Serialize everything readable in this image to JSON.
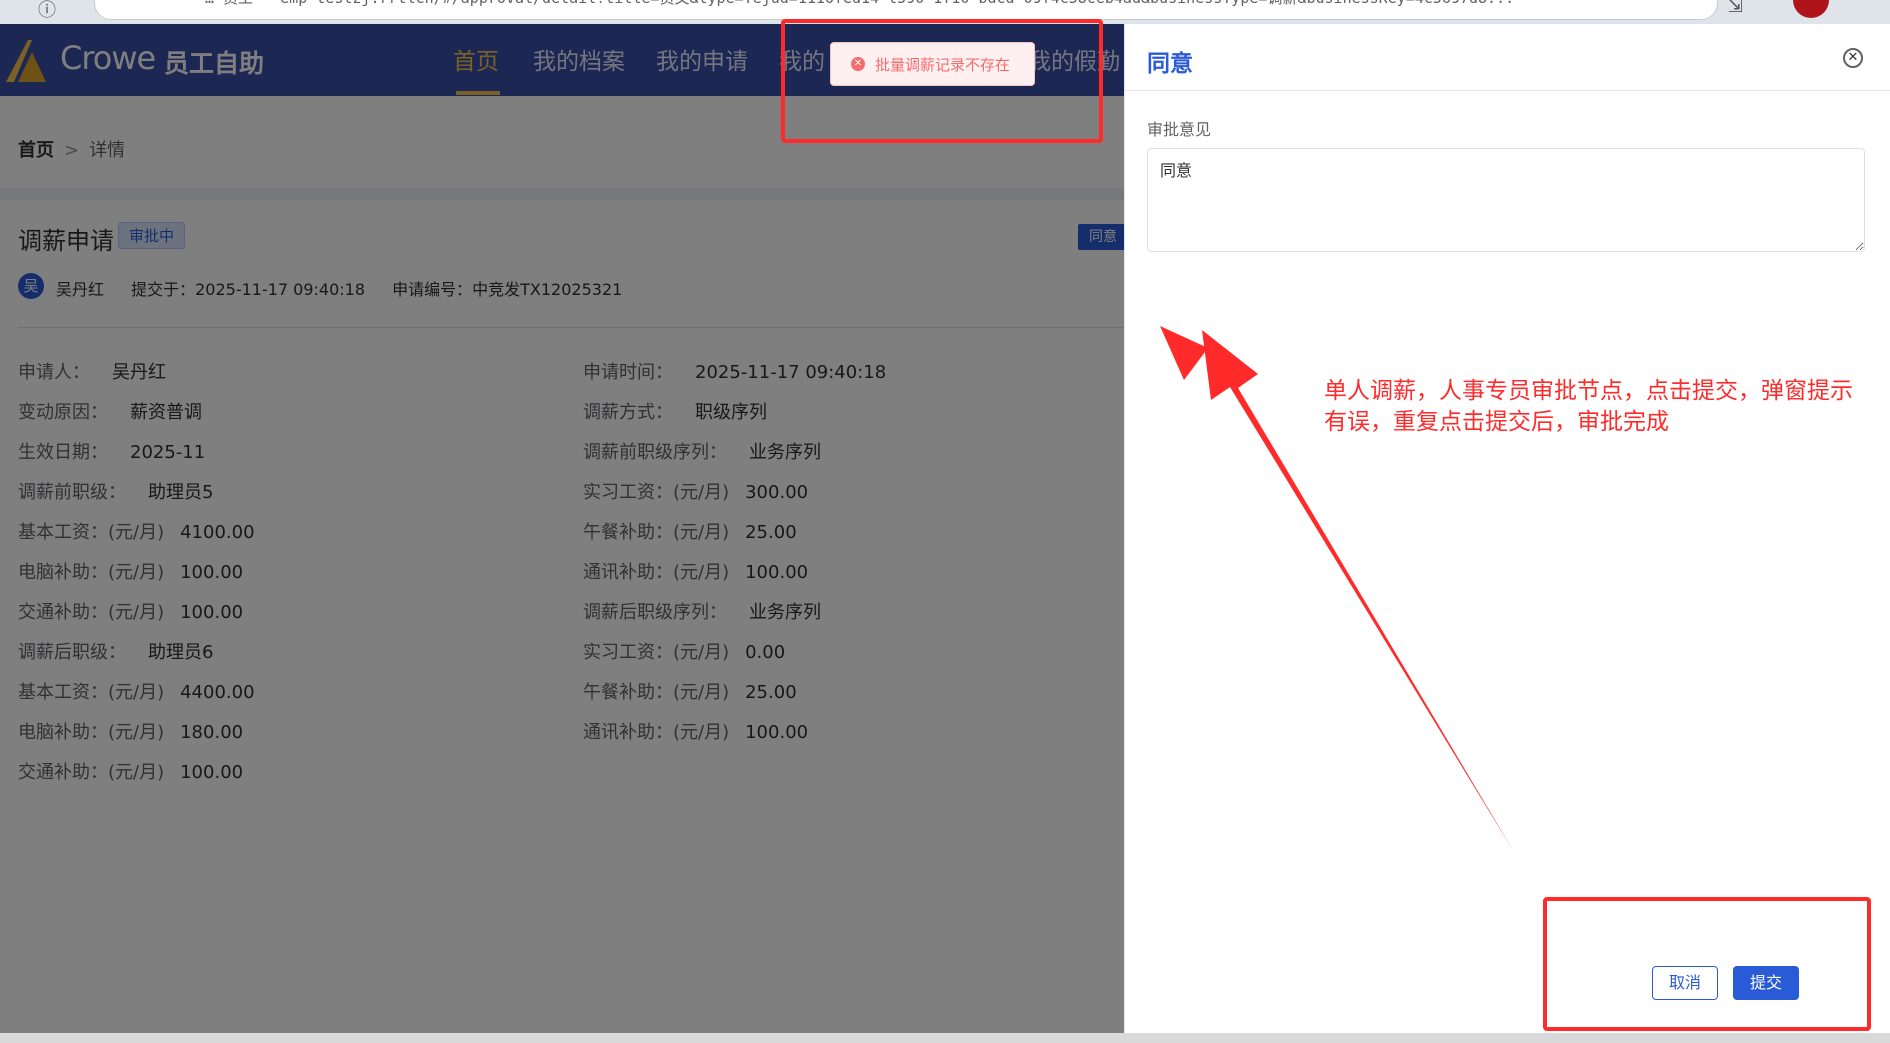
{
  "browser": {
    "url": "… 员工 - emp-testzj.rrtlch/#/approval/detail?title=员文&type=Tejud=1116fed14-t590-1f10-bdcd-09f4c58ceb4ad&businessType=调薪&businessKey=4c5697d8..."
  },
  "header": {
    "logo_text": "Crowe",
    "logo_sub": "员工自助",
    "nav": [
      "首页",
      "我的档案",
      "我的申请",
      "我的",
      "我的假勤"
    ],
    "active_nav": "首页"
  },
  "breadcrumb": {
    "home": "首页",
    "separator": ">",
    "current": "详情"
  },
  "page": {
    "title": "调薪申请",
    "status": "审批中",
    "agree_chip": "同意",
    "applicant_initial": "吴",
    "applicant": "吴丹红",
    "submitted": "提交于：2025-11-17 09:40:18",
    "request_no": "申请编号：中竞发TX12025321"
  },
  "fields_left": [
    {
      "label": "申请人：",
      "value": "吴丹红"
    },
    {
      "label": "变动原因：",
      "value": "薪资普调"
    },
    {
      "label": "生效日期：",
      "value": "2025-11"
    },
    {
      "label": "调薪前职级：",
      "value": "助理员5"
    },
    {
      "label": "基本工资：(元/月)",
      "value": "4100.00"
    },
    {
      "label": "电脑补助：(元/月)",
      "value": "100.00"
    },
    {
      "label": "交通补助：(元/月)",
      "value": "100.00"
    },
    {
      "label": "调薪后职级：",
      "value": "助理员6"
    },
    {
      "label": "基本工资：(元/月)",
      "value": "4400.00"
    },
    {
      "label": "电脑补助：(元/月)",
      "value": "180.00"
    },
    {
      "label": "交通补助：(元/月)",
      "value": "100.00"
    }
  ],
  "fields_right": [
    {
      "label": "申请时间：",
      "value": "2025-11-17 09:40:18"
    },
    {
      "label": "调薪方式：",
      "value": "职级序列"
    },
    {
      "label": "调薪前职级序列：",
      "value": "业务序列"
    },
    {
      "label": "实习工资：(元/月)",
      "value": "300.00"
    },
    {
      "label": "午餐补助：(元/月)",
      "value": "25.00"
    },
    {
      "label": "通讯补助：(元/月)",
      "value": "100.00"
    },
    {
      "label": "调薪后职级序列：",
      "value": "业务序列"
    },
    {
      "label": "实习工资：(元/月)",
      "value": "0.00"
    },
    {
      "label": "午餐补助：(元/月)",
      "value": "25.00"
    },
    {
      "label": "通讯补助：(元/月)",
      "value": "100.00"
    }
  ],
  "toast": {
    "message": "批量调薪记录不存在",
    "type": "error"
  },
  "drawer": {
    "title": "同意",
    "opinion_label": "审批意见",
    "opinion_value": "同意",
    "cancel_label": "取消",
    "submit_label": "提交"
  },
  "annotation": "单人调薪，人事专员审批节点，点击提交，弹窗提示有误，重复点击提交后，审批完成",
  "colors": {
    "header_bg": "#3a4ea8",
    "primary": "#2a5bd7",
    "error": "#f56c6c",
    "annotation_red": "#ff2b2b",
    "active_nav": "#f5c44f"
  }
}
